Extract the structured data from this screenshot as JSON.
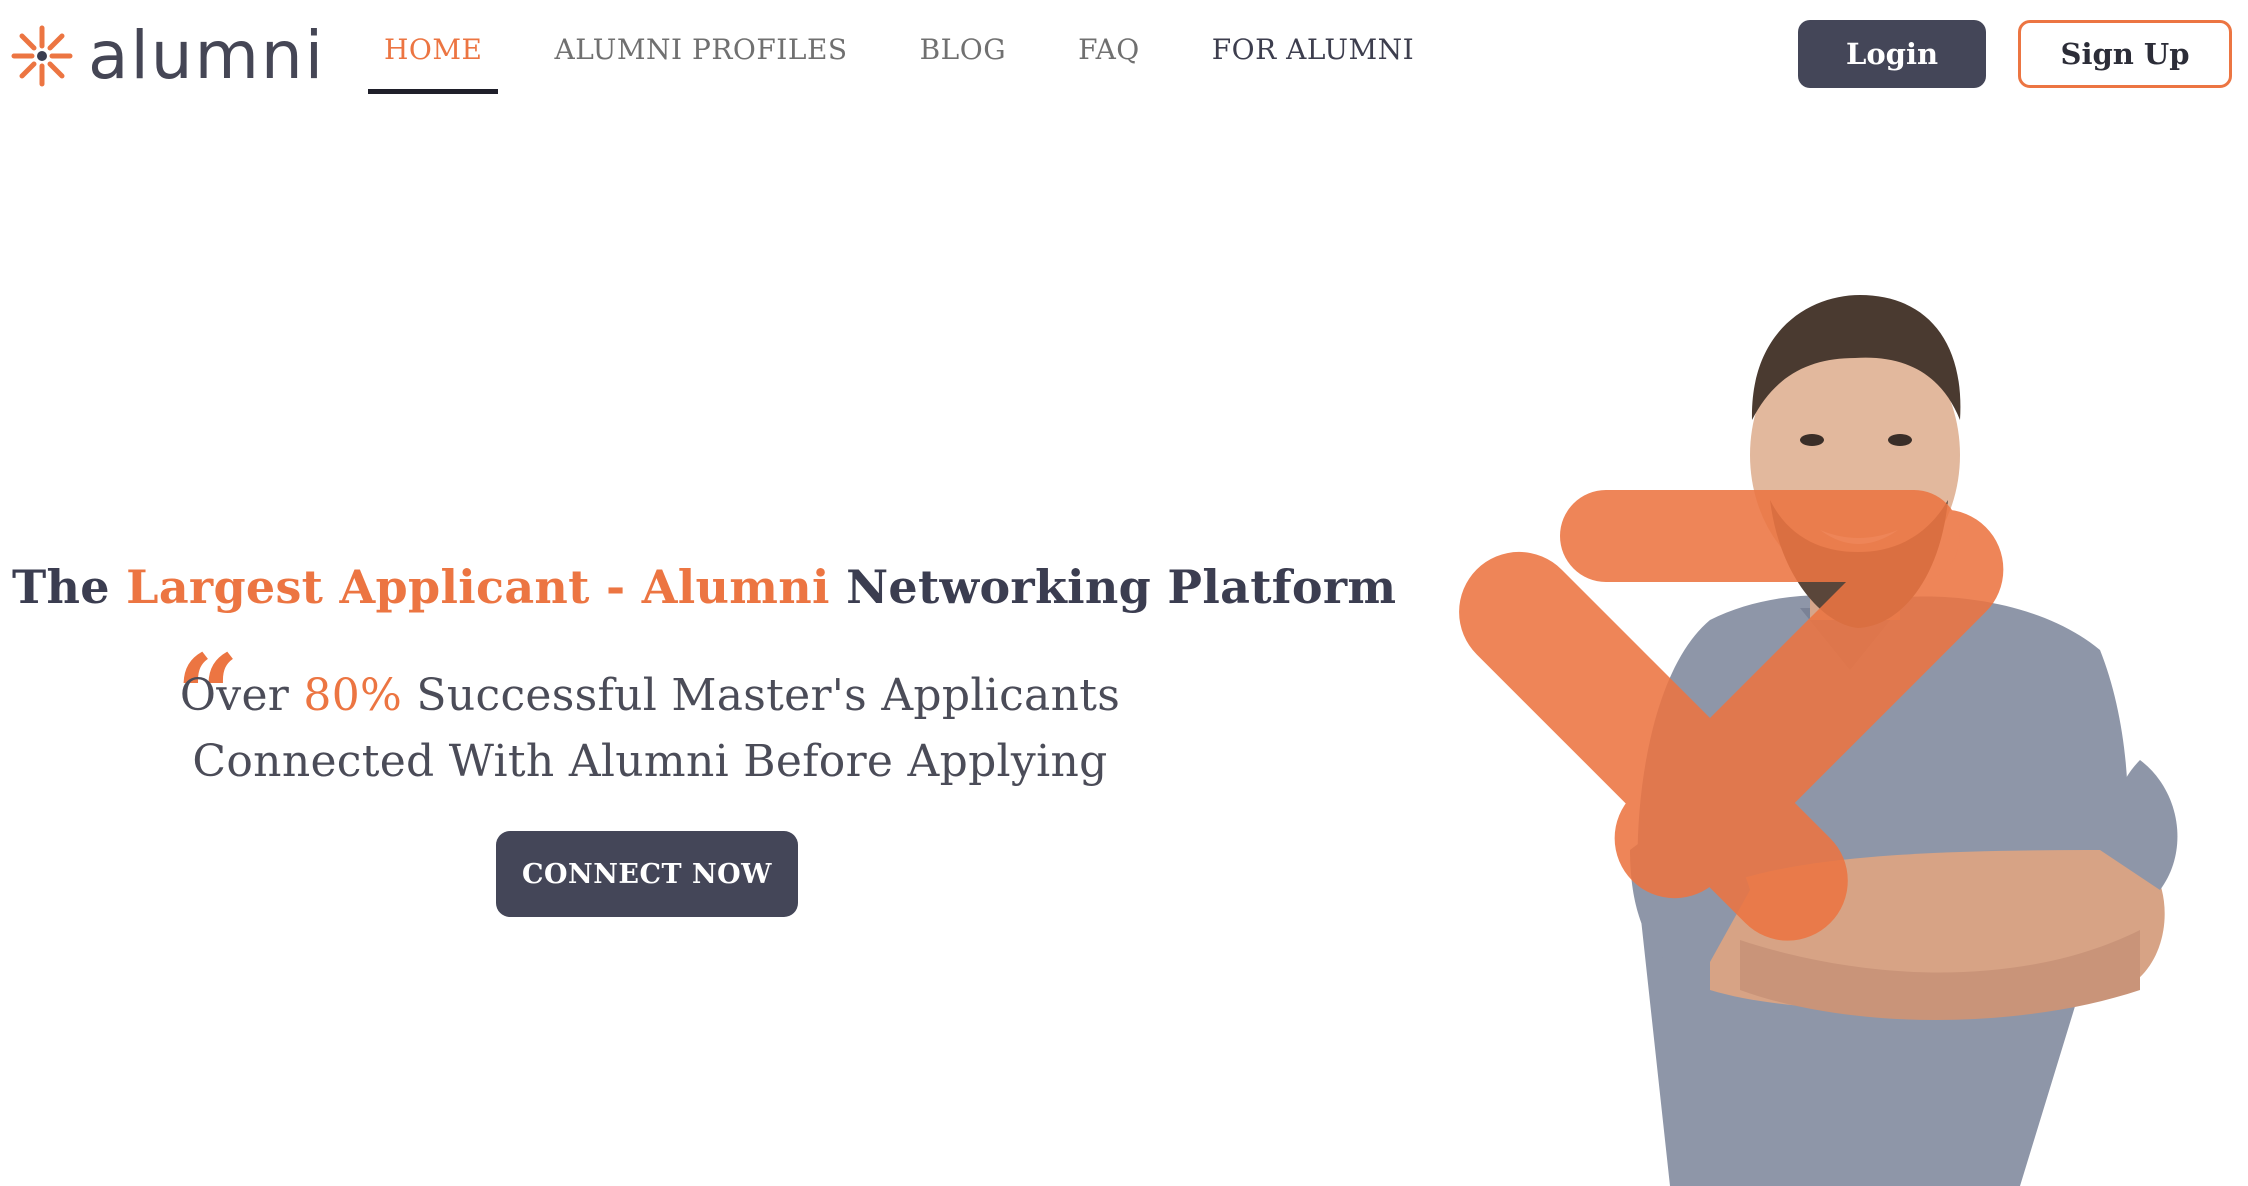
{
  "header": {
    "logo_text": "alumni",
    "nav": [
      {
        "label": "HOME",
        "active": true
      },
      {
        "label": "ALUMNI PROFILES",
        "active": false
      },
      {
        "label": "BLOG",
        "active": false
      },
      {
        "label": "FAQ",
        "active": false
      },
      {
        "label": "FOR ALUMNI",
        "active": false
      }
    ],
    "login_label": "Login",
    "signup_label": "Sign Up"
  },
  "hero": {
    "headline": {
      "part1": "The",
      "highlight": "Largest Applicant - Alumni",
      "part2": "Networking Platform"
    },
    "quote_mark": "“",
    "subline_1": {
      "before": "Over",
      "highlight": "80%",
      "after": "Successful Master's Applicants"
    },
    "subline_2": "Connected With Alumni Before Applying",
    "cta_label": "CONNECT NOW"
  },
  "colors": {
    "accent": "#ec7542",
    "dark": "#444658",
    "text": "#3b3d50"
  }
}
